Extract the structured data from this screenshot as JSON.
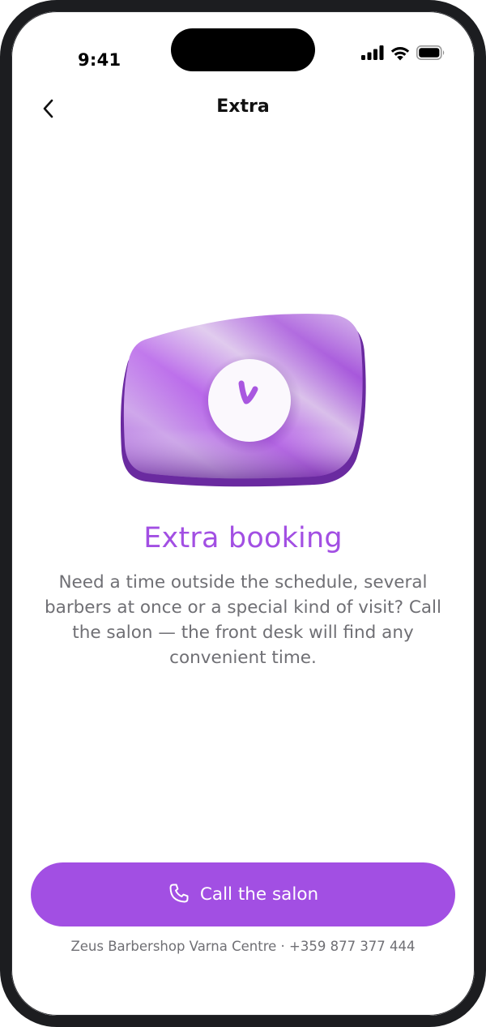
{
  "status_bar": {
    "time": "9:41"
  },
  "nav": {
    "title": "Extra",
    "back_icon": "chevron-left-icon"
  },
  "content": {
    "illustration_icon": "clock-icon",
    "headline": "Extra booking",
    "body": "Need a time outside the schedule, several barbers at once or a special kind of visit? Call the salon — the front desk will find any convenient time."
  },
  "cta": {
    "label": "Call the salon",
    "icon": "phone-icon"
  },
  "footer": {
    "info": "Zeus Barbershop Varna Centre · +359 877 377 444"
  },
  "colors": {
    "accent": "#a24fe3",
    "text_secondary": "#6f6f74",
    "frame": "#1c1d20"
  }
}
